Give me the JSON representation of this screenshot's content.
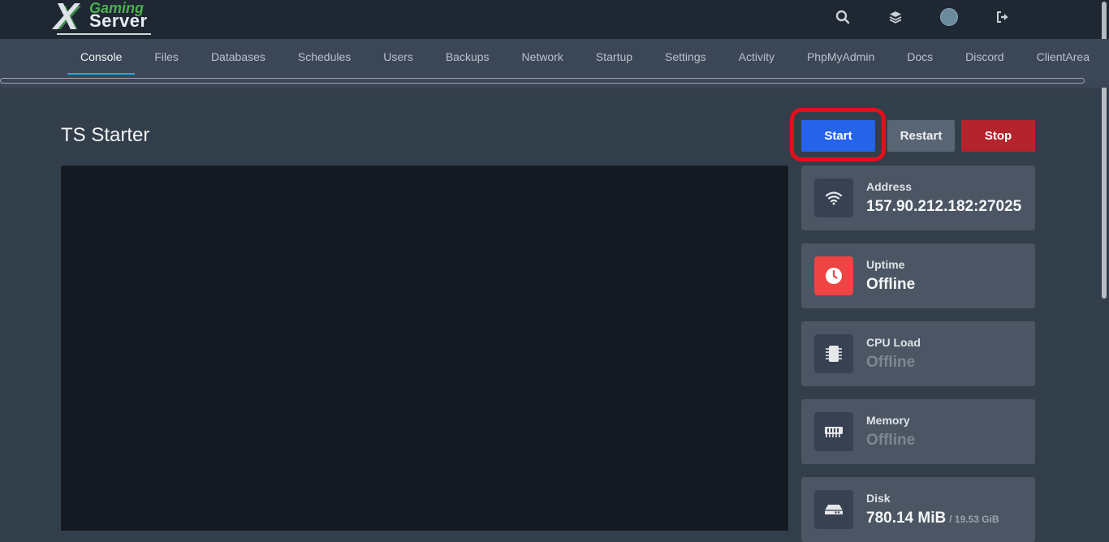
{
  "logo": {
    "mark": "X",
    "line1": "Gaming",
    "line2": "Server"
  },
  "top_icons": [
    "search-icon",
    "layers-icon",
    "avatar",
    "logout-icon"
  ],
  "nav": {
    "items": [
      "Console",
      "Files",
      "Databases",
      "Schedules",
      "Users",
      "Backups",
      "Network",
      "Startup",
      "Settings",
      "Activity",
      "PhpMyAdmin",
      "Docs",
      "Discord",
      "ClientArea"
    ],
    "active": "Console"
  },
  "server": {
    "name": "TS Starter"
  },
  "controls": {
    "start": "Start",
    "restart": "Restart",
    "stop": "Stop"
  },
  "colors": {
    "start": "#2563eb",
    "restart": "#5a6573",
    "stop": "#b3242c",
    "highlight": "#e3101b",
    "uptime_icon_bg": "#ef4444"
  },
  "stats": {
    "address": {
      "label": "Address",
      "value": "157.90.212.182:27025",
      "icon": "wifi-icon"
    },
    "uptime": {
      "label": "Uptime",
      "value": "Offline",
      "icon": "clock-icon"
    },
    "cpu": {
      "label": "CPU Load",
      "value": "Offline",
      "icon": "cpu-chip-icon"
    },
    "memory": {
      "label": "Memory",
      "value": "Offline",
      "icon": "memory-icon"
    },
    "disk": {
      "label": "Disk",
      "value": "780.14 MiB",
      "limit": "/ 19.53 GiB",
      "icon": "hard-drive-icon"
    }
  }
}
